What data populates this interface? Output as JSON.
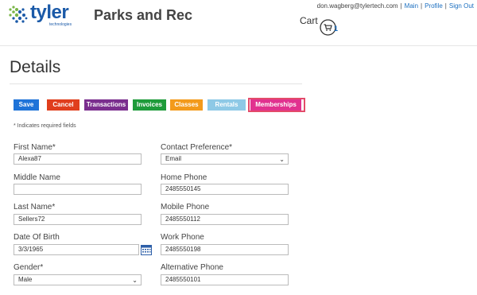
{
  "brand": {
    "logo_text": "tyler",
    "logo_sub": "technologies",
    "app_title": "Parks and Rec"
  },
  "user": {
    "email": "don.wagberg@tylertech.com",
    "links": [
      "Main",
      "Profile",
      "Sign Out"
    ]
  },
  "cart": {
    "label": "Cart",
    "count": "1"
  },
  "page": {
    "title": "Details",
    "required_note": "* Indicates required fields"
  },
  "toolbar": [
    {
      "label": "Save",
      "color": "#1e73d8"
    },
    {
      "label": "Cancel",
      "color": "#e03e1d"
    },
    {
      "label": "Transactions",
      "color": "#7a2e8e"
    },
    {
      "label": "Invoices",
      "color": "#1e9b3a"
    },
    {
      "label": "Classes",
      "color": "#f39a1b"
    },
    {
      "label": "Rentals",
      "color": "#8ec9e6"
    },
    {
      "label": "Memberships",
      "color": "#e1318f"
    }
  ],
  "form": {
    "first_name": {
      "label": "First Name*",
      "value": "Alexa87"
    },
    "middle_name": {
      "label": "Middle Name",
      "value": ""
    },
    "last_name": {
      "label": "Last Name*",
      "value": "Sellers72"
    },
    "date_of_birth": {
      "label": "Date Of Birth",
      "value": "3/3/1965"
    },
    "gender": {
      "label": "Gender*",
      "value": "Male"
    },
    "contact_preference": {
      "label": "Contact Preference*",
      "value": "Email"
    },
    "home_phone": {
      "label": "Home Phone",
      "value": "2485550145"
    },
    "mobile_phone": {
      "label": "Mobile Phone",
      "value": "2485550112"
    },
    "work_phone": {
      "label": "Work Phone",
      "value": "2485550198"
    },
    "alternative_phone": {
      "label": "Alternative Phone",
      "value": "2485550101"
    }
  }
}
